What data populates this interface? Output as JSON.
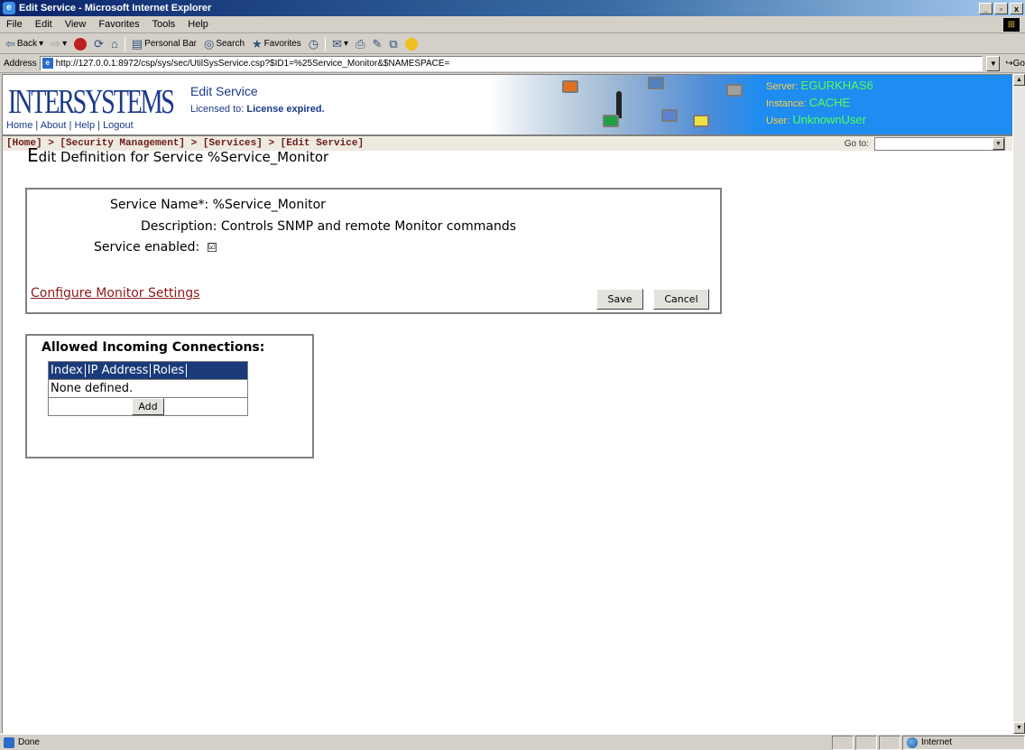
{
  "window": {
    "title": "Edit Service - Microsoft Internet Explorer",
    "min": "_",
    "max": "▫",
    "close": "x"
  },
  "menu": [
    "File",
    "Edit",
    "View",
    "Favorites",
    "Tools",
    "Help"
  ],
  "toolbar": {
    "back": "Back",
    "personal_bar": "Personal Bar",
    "search": "Search",
    "favorites": "Favorites"
  },
  "address": {
    "label": "Address",
    "url": "http://127.0.0.1:8972/csp/sys/sec/UtilSysService.csp?$ID1=%25Service_Monitor&$NAMESPACE=",
    "go": "Go"
  },
  "banner": {
    "logo": "INTERSYSTEMS",
    "links": [
      "Home",
      "About",
      "Help",
      "Logout"
    ],
    "app_title": "Edit Service",
    "license_label": "Licensed to:",
    "license_value": "License expired.",
    "server_label": "Server:",
    "server_value": "EGURKHAS6",
    "instance_label": "Instance:",
    "instance_value": "CACHE",
    "user_label": "User:",
    "user_value": "UnknownUser"
  },
  "breadcrumb": "[Home] > [Security Management] > [Services] > [Edit Service]",
  "goto_label": "Go to:",
  "heading": {
    "first": "E",
    "rest": "dit Definition for Service %Service_Monitor"
  },
  "form": {
    "name_label": "Service Name*:",
    "name_value": "%Service_Monitor",
    "desc_label": "Description:",
    "desc_value": "Controls SNMP and remote Monitor commands",
    "enabled_label": "Service enabled:",
    "enabled_checked": "☑",
    "config_link": "Configure Monitor Settings",
    "save": "Save",
    "cancel": "Cancel"
  },
  "connections": {
    "title": "Allowed Incoming Connections:",
    "columns": [
      "Index",
      "IP Address",
      "Roles"
    ],
    "empty": "None defined.",
    "add": "Add"
  },
  "status": {
    "text": "Done",
    "zone": "Internet"
  },
  "colors": {
    "accent": "#1e8cf0",
    "breadcrumb": "#6b1a1a",
    "link": "#8b1a1a",
    "table_header": "#1a3a7a"
  }
}
